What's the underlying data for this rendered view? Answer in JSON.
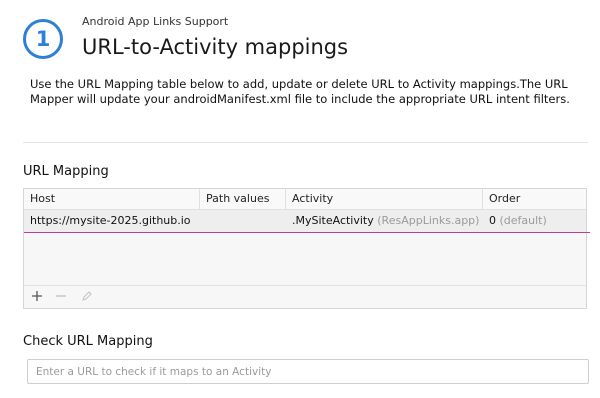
{
  "header": {
    "step_number": "1",
    "subtitle": "Android App Links Support",
    "title": "URL-to-Activity mappings",
    "description": "Use the URL Mapping table below to add, update or delete URL to Activity mappings.The URL Mapper will update your androidManifest.xml file to include the appropriate URL intent filters."
  },
  "url_mapping": {
    "section_title": "URL Mapping",
    "columns": [
      "Host",
      "Path values",
      "Activity",
      "Order"
    ],
    "rows": [
      {
        "host": "https://mysite-2025.github.io",
        "path_values": "",
        "activity": ".MySiteActivity",
        "activity_module": "(ResAppLinks.app)",
        "order": "0",
        "order_note": "(default)"
      }
    ],
    "toolbar": {
      "add_icon": "plus-icon",
      "remove_icon": "minus-icon",
      "edit_icon": "pencil-icon"
    }
  },
  "check_url": {
    "section_title": "Check URL Mapping",
    "value": "",
    "placeholder": "Enter a URL to check if it maps to an Activity"
  },
  "colors": {
    "accent": "#2f7fd6",
    "drop_indicator": "#c03a9a"
  }
}
